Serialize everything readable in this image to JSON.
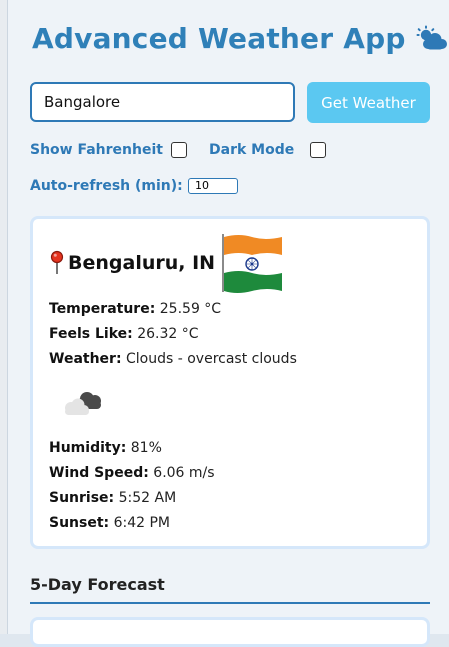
{
  "header": {
    "title": "Advanced Weather App",
    "icon": "sun-behind-cloud-icon"
  },
  "search": {
    "value": "Bangalore",
    "button_label": "Get Weather"
  },
  "options": {
    "fahrenheit_label": "Show Fahrenheit",
    "fahrenheit_checked": false,
    "dark_mode_label": "Dark Mode",
    "dark_mode_checked": false,
    "refresh_label": "Auto-refresh (min):",
    "refresh_value": "10"
  },
  "weather": {
    "location": "Bengaluru, IN",
    "location_icon": "pin-icon",
    "flag_icon": "india-flag-icon",
    "weather_icon": "overcast-clouds-icon",
    "rows_top": [
      {
        "label": "Temperature:",
        "value": "25.59 °C"
      },
      {
        "label": "Feels Like:",
        "value": "26.32 °C"
      },
      {
        "label": "Weather:",
        "value": "Clouds - overcast clouds"
      }
    ],
    "rows_bottom": [
      {
        "label": "Humidity:",
        "value": "81%"
      },
      {
        "label": "Wind Speed:",
        "value": "6.06 m/s"
      },
      {
        "label": "Sunrise:",
        "value": "5:52 AM"
      },
      {
        "label": "Sunset:",
        "value": "6:42 PM"
      }
    ]
  },
  "forecast": {
    "title": "5-Day Forecast"
  },
  "colors": {
    "accent": "#2e79b6",
    "button": "#5bc8f1",
    "title": "#2f80b8"
  }
}
